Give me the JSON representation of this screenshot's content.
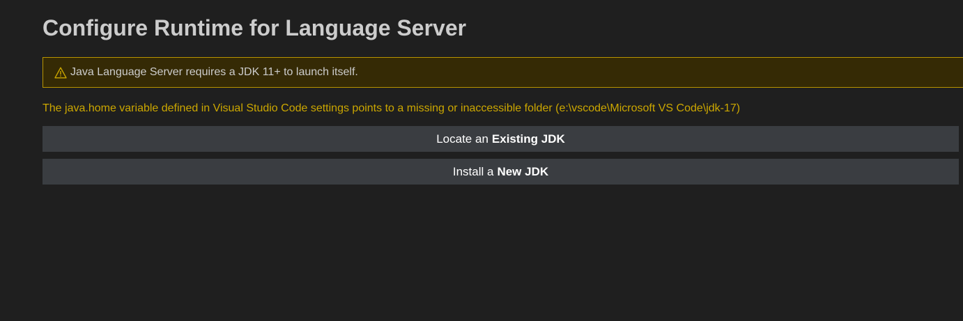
{
  "page": {
    "title": "Configure Runtime for Language Server"
  },
  "warning": {
    "icon": "warning-icon",
    "text": "Java Language Server requires a JDK 11+ to launch itself.",
    "colors": {
      "background": "#352a05",
      "border": "#b89500",
      "icon": "#cca700"
    }
  },
  "message": {
    "text": "The java.home variable defined in Visual Studio Code settings points to a missing or inaccessible folder (e:\\vscode\\Microsoft VS Code\\jdk-17)",
    "color": "#cca700"
  },
  "actions": {
    "locate": {
      "prefix": "Locate an",
      "emphasis": "Existing JDK"
    },
    "install": {
      "prefix": "Install a",
      "emphasis": "New JDK"
    }
  },
  "theme": {
    "background": "#1f1f1f",
    "button_background": "#3a3d41",
    "title_color": "#cccccc"
  }
}
